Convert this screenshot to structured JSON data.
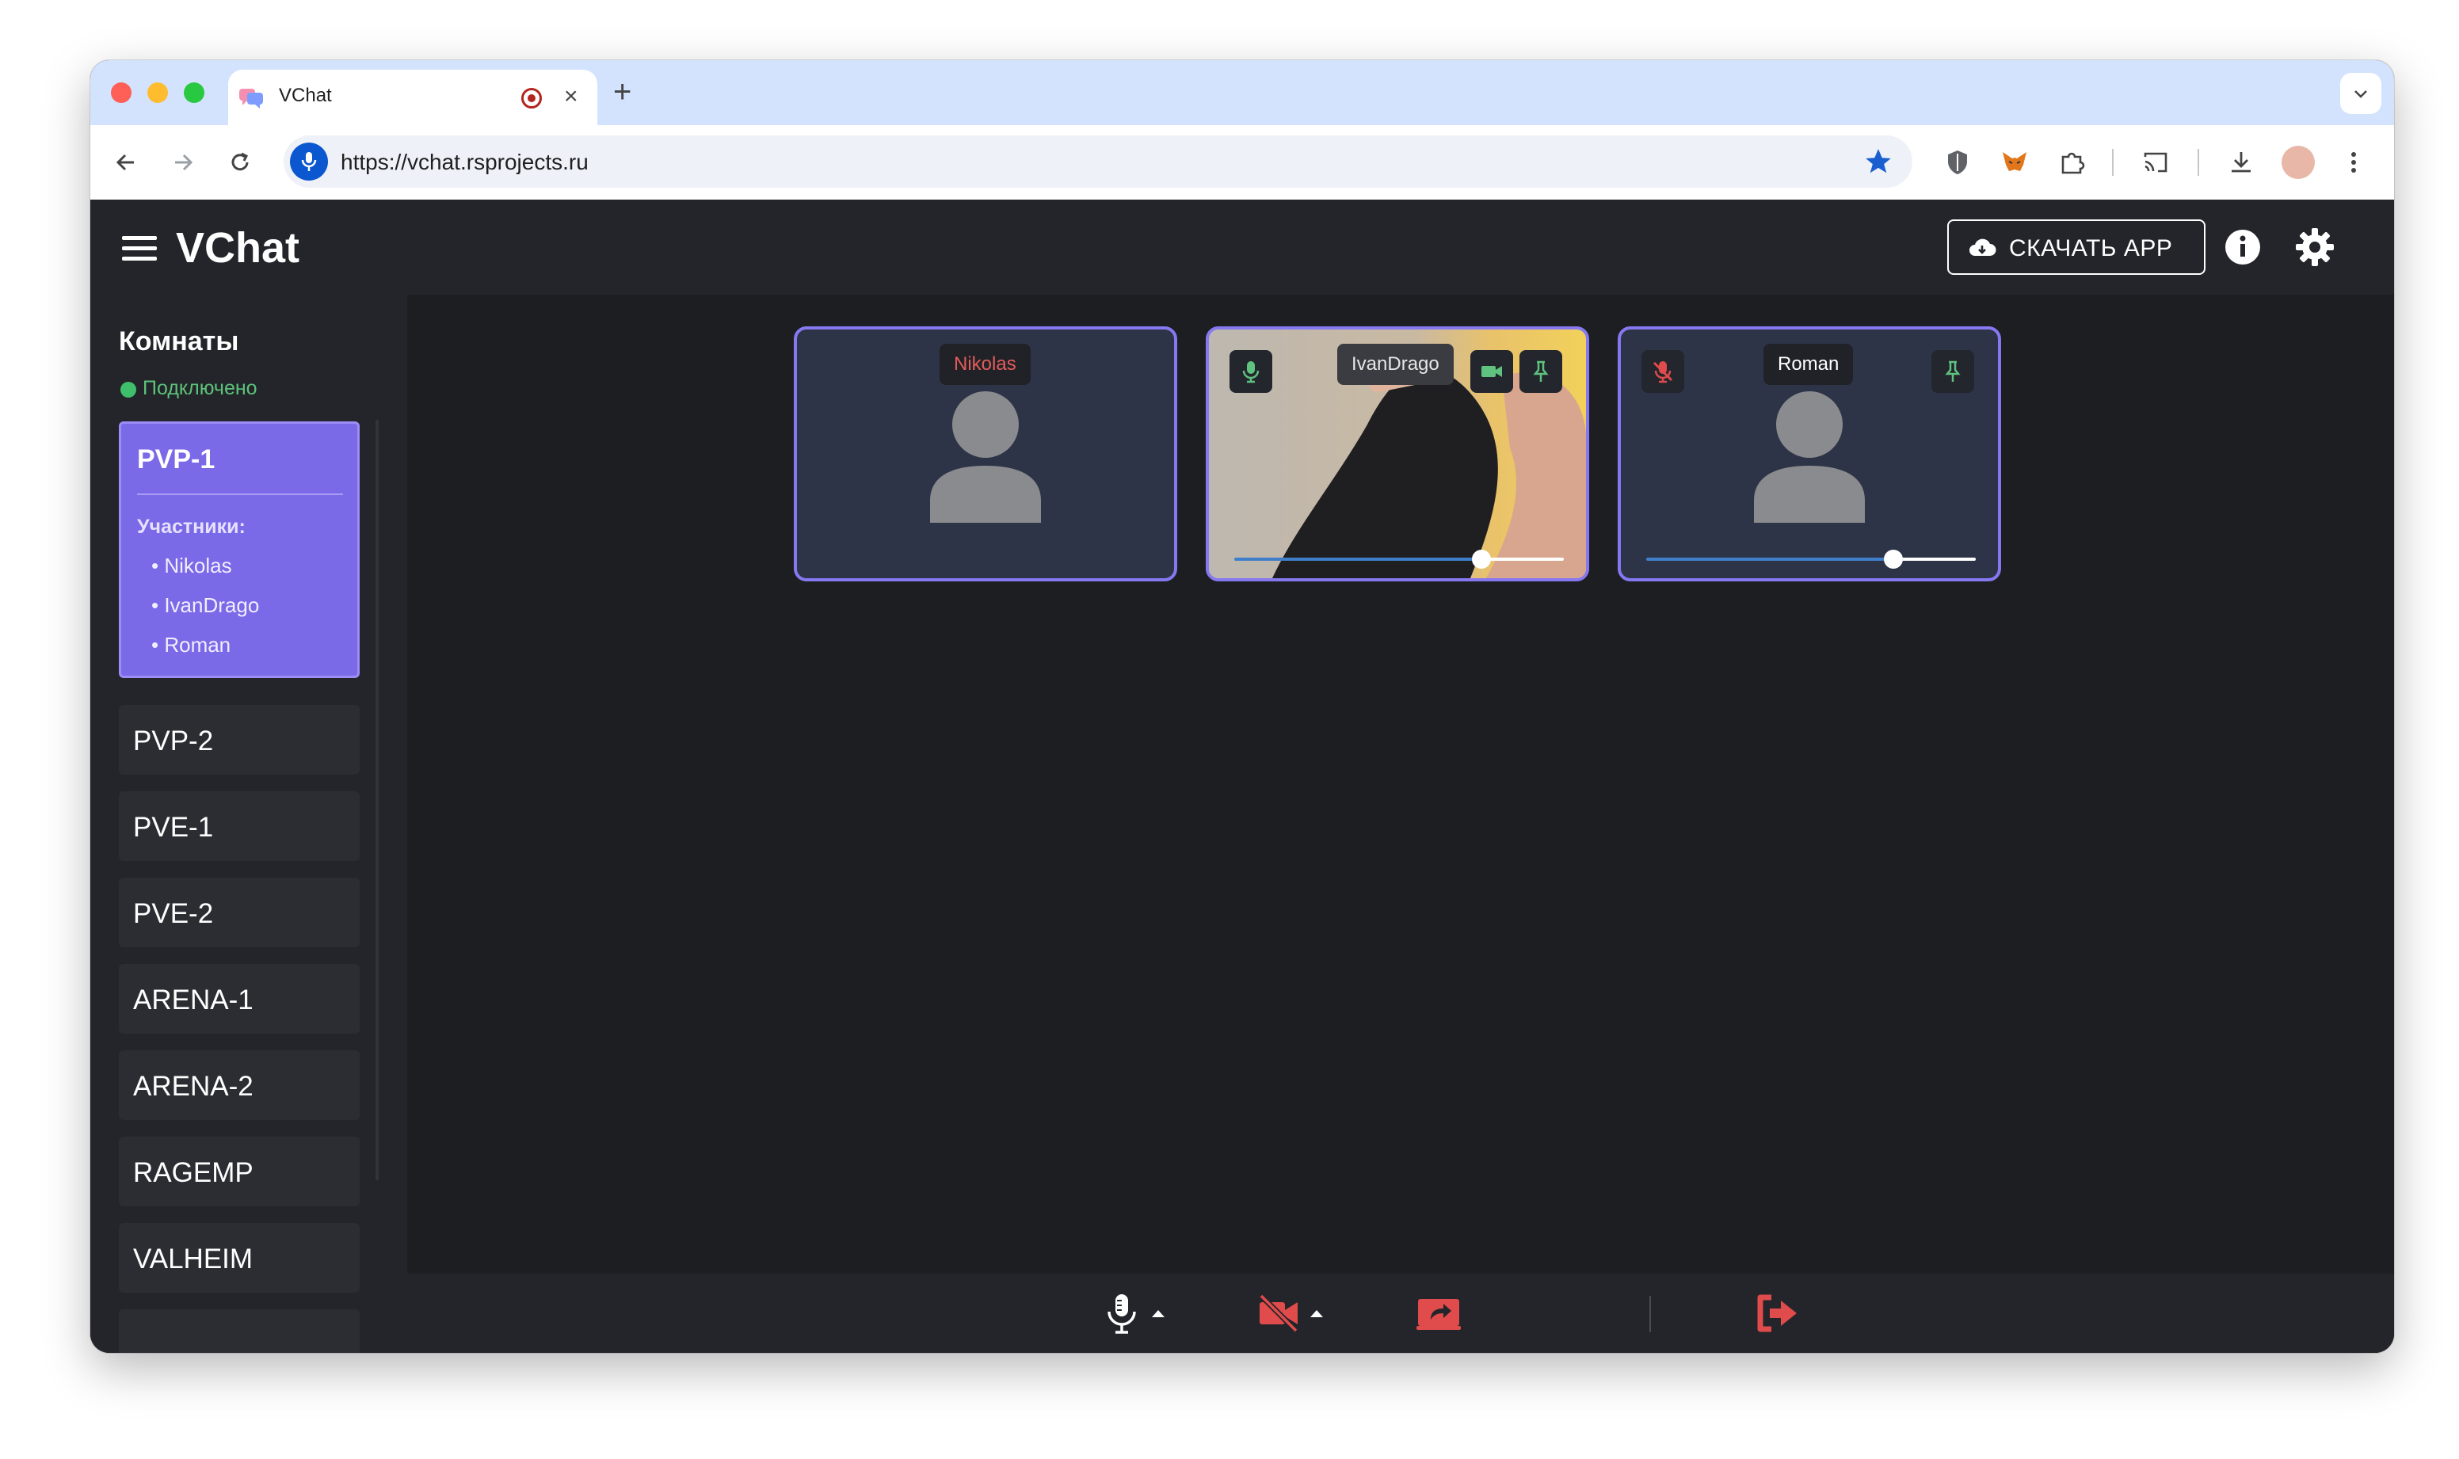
{
  "browser": {
    "tab_title": "VChat",
    "url": "https://vchat.rsprojects.ru",
    "new_tab_symbol": "+",
    "close_tab_symbol": "×"
  },
  "app": {
    "title": "VChat",
    "download_label": "СКАЧАТЬ APP"
  },
  "sidebar": {
    "title": "Комнаты",
    "status": "Подключено",
    "active_room": {
      "name": "PVP-1",
      "members_label": "Участники:",
      "members": [
        "• Nikolas",
        "• IvanDrago",
        "• Roman"
      ]
    },
    "rooms": [
      "PVP-2",
      "PVE-1",
      "PVE-2",
      "ARENA-1",
      "ARENA-2",
      "RAGEMP",
      "VALHEIM"
    ]
  },
  "participants": [
    {
      "name": "Nikolas",
      "name_color": "#e35b5b",
      "video": false,
      "mic_muted": null,
      "volume": null
    },
    {
      "name": "IvanDrago",
      "name_color": "#e6e6e6",
      "video": true,
      "mic_muted": false,
      "volume": 0.75
    },
    {
      "name": "Roman",
      "name_color": "#ffffff",
      "video": false,
      "mic_muted": true,
      "volume": 0.75
    }
  ],
  "colors": {
    "accent": "#7b6ae8",
    "connected": "#3fbf6b",
    "danger": "#e04b4b",
    "active_green": "#4caf50"
  },
  "icons": {
    "mic": "mic-icon",
    "camera_off": "camera-off-icon",
    "screen_share": "screen-share-icon",
    "leave": "leave-icon",
    "pin": "pin-icon",
    "settings": "gear-icon",
    "info": "info-icon",
    "download": "cloud-download-icon"
  }
}
